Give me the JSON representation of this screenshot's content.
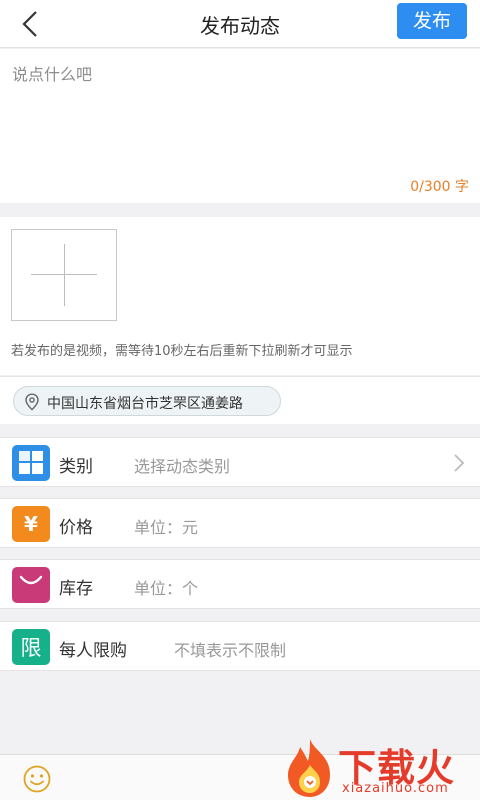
{
  "header": {
    "title": "发布动态",
    "publish_label": "发布"
  },
  "compose": {
    "placeholder": "说点什么吧",
    "counter": "0/300 字"
  },
  "media": {
    "hint": "若发布的是视频，需等待10秒左右后重新下拉刷新才可显示"
  },
  "location": {
    "text": "中国山东省烟台市芝罘区通姜路"
  },
  "fields": {
    "category": {
      "label": "类别",
      "value": "选择动态类别"
    },
    "price": {
      "label": "价格",
      "value": "单位：元",
      "icon_char": "¥"
    },
    "stock": {
      "label": "库存",
      "value": "单位：个"
    },
    "limit": {
      "label": "每人限购",
      "value": "不填表示不限制",
      "icon_char": "限"
    }
  },
  "watermark": {
    "brand": "下载火",
    "domain": "xiazaihuo.com"
  },
  "colors": {
    "accent": "#2d8df0",
    "counter": "#e6802b",
    "category_icon": "#2f8fe6",
    "price_icon": "#f28a1e",
    "stock_icon": "#c93a78",
    "limit_icon": "#16b08a",
    "brand_red": "#e53b2a"
  },
  "icons": [
    "back-arrow-icon",
    "plus-icon",
    "location-pin-icon",
    "grid-icon",
    "yen-icon",
    "bag-icon",
    "limit-icon",
    "chevron-right-icon",
    "smiley-icon",
    "fire-logo-icon"
  ]
}
